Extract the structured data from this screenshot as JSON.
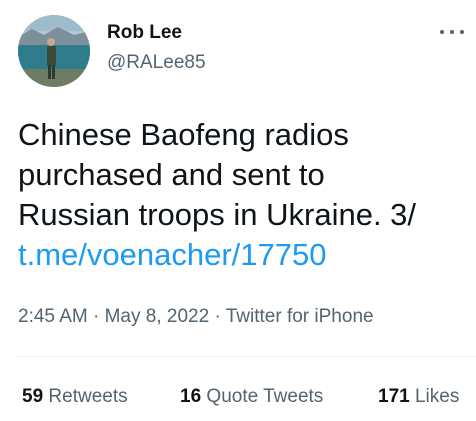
{
  "author": {
    "name": "Rob Lee",
    "handle": "@RALee85",
    "avatar_icon": "profile-photo-person-by-lake"
  },
  "tweet": {
    "text_lines": [
      "Chinese Baofeng radios",
      "purchased and sent to",
      "Russian troops in Ukraine. 3/"
    ],
    "link": "t.me/voenacher/17750"
  },
  "meta": {
    "time": "2:45 AM",
    "date": "May 8, 2022",
    "source": "Twitter for iPhone",
    "separator": "·"
  },
  "stats": {
    "retweets": {
      "count": "59",
      "label": "Retweets"
    },
    "quotes": {
      "count": "16",
      "label": "Quote Tweets"
    },
    "likes": {
      "count": "171",
      "label": "Likes"
    }
  },
  "icons": {
    "more": "more-options-icon"
  },
  "colors": {
    "link": "#1d9bf0",
    "primary_text": "#0f1419",
    "secondary_text": "#536471",
    "divider": "#eff3f4"
  }
}
